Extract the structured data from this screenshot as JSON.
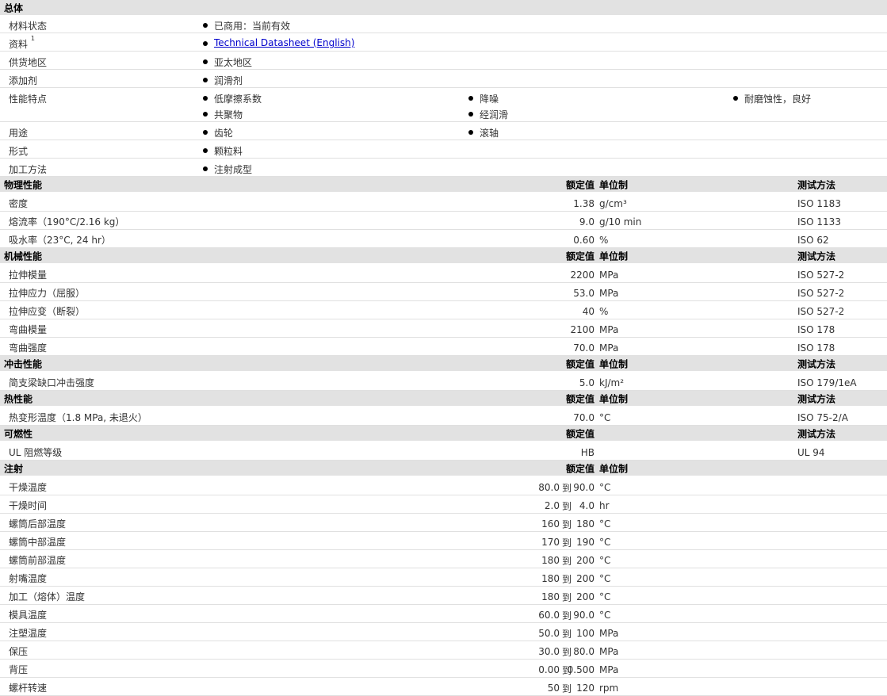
{
  "general": {
    "header": "总体",
    "rows": [
      {
        "label": "材料状态",
        "items": [
          [
            "已商用：当前有效"
          ]
        ]
      },
      {
        "label": "资料",
        "note": "1",
        "items": [
          [
            "Technical Datasheet (English)"
          ]
        ],
        "link": true
      },
      {
        "label": "供货地区",
        "items": [
          [
            "亚太地区"
          ]
        ]
      },
      {
        "label": "添加剂",
        "items": [
          [
            "润滑剂"
          ]
        ]
      },
      {
        "label": "性能特点",
        "items": [
          [
            "低摩擦系数",
            "共聚物"
          ],
          [
            "降噪",
            "经润滑"
          ],
          [
            "耐磨蚀性，良好"
          ]
        ]
      },
      {
        "label": "用途",
        "items": [
          [
            "齿轮"
          ],
          [
            "滚轴"
          ]
        ]
      },
      {
        "label": "形式",
        "items": [
          [
            "颗粒料"
          ]
        ]
      },
      {
        "label": "加工方法",
        "items": [
          [
            "注射成型"
          ]
        ]
      }
    ]
  },
  "columns": {
    "nominal": "额定值",
    "unit": "单位制",
    "method": "测试方法"
  },
  "sections": [
    {
      "title": "物理性能",
      "show_unit": true,
      "show_method": true,
      "rows": [
        {
          "prop": "密度",
          "value": "1.38",
          "unit": "g/cm³",
          "method": "ISO 1183"
        },
        {
          "prop": "熔流率（190°C/2.16 kg）",
          "value": "9.0",
          "unit": "g/10 min",
          "method": "ISO 1133"
        },
        {
          "prop": "吸水率（23°C, 24 hr）",
          "value": "0.60",
          "unit": "%",
          "method": "ISO 62"
        }
      ]
    },
    {
      "title": "机械性能",
      "show_unit": true,
      "show_method": true,
      "rows": [
        {
          "prop": "拉伸模量",
          "value": "2200",
          "unit": "MPa",
          "method": "ISO 527-2"
        },
        {
          "prop": "拉伸应力（屈服）",
          "value": "53.0",
          "unit": "MPa",
          "method": "ISO 527-2"
        },
        {
          "prop": "拉伸应变（断裂）",
          "value": "40",
          "unit": "%",
          "method": "ISO 527-2"
        },
        {
          "prop": "弯曲模量",
          "value": "2100",
          "unit": "MPa",
          "method": "ISO 178"
        },
        {
          "prop": "弯曲强度",
          "value": "70.0",
          "unit": "MPa",
          "method": "ISO 178"
        }
      ]
    },
    {
      "title": "冲击性能",
      "show_unit": true,
      "show_method": true,
      "rows": [
        {
          "prop": "简支梁缺口冲击强度",
          "value": "5.0",
          "unit": "kJ/m²",
          "method": "ISO 179/1eA"
        }
      ]
    },
    {
      "title": "热性能",
      "show_unit": true,
      "show_method": true,
      "rows": [
        {
          "prop": "热变形温度（1.8 MPa, 未退火）",
          "value": "70.0",
          "unit": "°C",
          "method": "ISO 75-2/A"
        }
      ]
    },
    {
      "title": "可燃性",
      "show_unit": false,
      "show_method": true,
      "rows": [
        {
          "prop": "UL 阻燃等级",
          "value": "HB",
          "unit": "",
          "method": "UL 94"
        }
      ]
    }
  ],
  "injection": {
    "title": "注射",
    "range_word": "到",
    "rows": [
      {
        "prop": "干燥温度",
        "min": "80.0",
        "max": "90.0",
        "unit": "°C"
      },
      {
        "prop": "干燥时间",
        "min": "2.0",
        "max": "4.0",
        "unit": "hr"
      },
      {
        "prop": "螺筒后部温度",
        "min": "160",
        "max": "180",
        "unit": "°C"
      },
      {
        "prop": "螺筒中部温度",
        "min": "170",
        "max": "190",
        "unit": "°C"
      },
      {
        "prop": "螺筒前部温度",
        "min": "180",
        "max": "200",
        "unit": "°C"
      },
      {
        "prop": "射嘴温度",
        "min": "180",
        "max": "200",
        "unit": "°C"
      },
      {
        "prop": "加工（熔体）温度",
        "min": "180",
        "max": "200",
        "unit": "°C"
      },
      {
        "prop": "模具温度",
        "min": "60.0",
        "max": "90.0",
        "unit": "°C"
      },
      {
        "prop": "注塑温度",
        "min": "50.0",
        "max": "100",
        "unit": "MPa"
      },
      {
        "prop": "保压",
        "min": "30.0",
        "max": "80.0",
        "unit": "MPa"
      },
      {
        "prop": "背压",
        "min": "0.00",
        "max": "0.500",
        "unit": "MPa"
      },
      {
        "prop": "螺杆转速",
        "min": "50",
        "max": "120",
        "unit": "rpm"
      }
    ]
  }
}
